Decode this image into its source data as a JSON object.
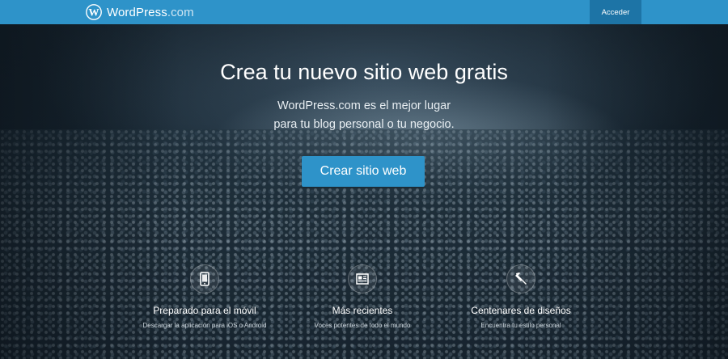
{
  "header": {
    "brand_name": "WordPress",
    "brand_suffix": ".com",
    "login_label": "Acceder",
    "logo_icon": "wordpress-logo-icon",
    "bar_color": "#2e93c9",
    "login_color": "#1d74a6"
  },
  "hero": {
    "headline": "Crea tu nuevo sitio web gratis",
    "subline_1": "WordPress.com es el mejor lugar",
    "subline_2": "para tu blog personal o tu negocio.",
    "cta_label": "Crear sitio web",
    "cta_color": "#2e93c9"
  },
  "features": [
    {
      "icon": "mobile-icon",
      "title": "Preparado para el móvil",
      "description": "Descargar la aplicación para iOS o Android"
    },
    {
      "icon": "newspaper-icon",
      "title": "Más recientes",
      "description": "Voces potentes de todo el mundo"
    },
    {
      "icon": "paintbrush-icon",
      "title": "Centenares de diseños",
      "description": "Encuentra tu estilo personal"
    }
  ]
}
